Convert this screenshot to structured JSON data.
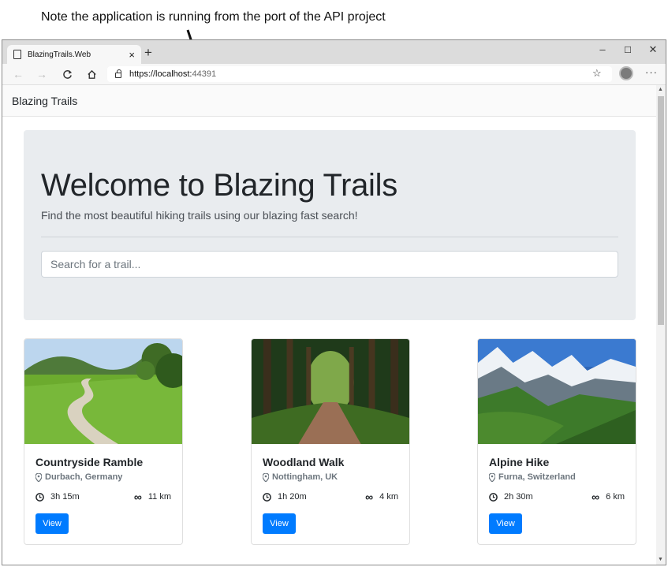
{
  "annotation": "Note the application is running from the port of the API project",
  "browser": {
    "tab_title": "BlazingTrails.Web",
    "tab_close": "×",
    "new_tab": "+",
    "window_controls": {
      "minimize": "–",
      "maximize": "☐",
      "close": "✕"
    },
    "url_host": "https://localhost:",
    "url_port": "44391",
    "more": "···"
  },
  "site": {
    "brand": "Blazing Trails",
    "hero": {
      "title": "Welcome to Blazing Trails",
      "lead": "Find the most beautiful hiking trails using our blazing fast search!",
      "search_placeholder": "Search for a trail..."
    },
    "trails": [
      {
        "name": "Countryside Ramble",
        "location": "Durbach, Germany",
        "time": "3h 15m",
        "distance": "11 km",
        "button": "View"
      },
      {
        "name": "Woodland Walk",
        "location": "Nottingham, UK",
        "time": "1h 20m",
        "distance": "4 km",
        "button": "View"
      },
      {
        "name": "Alpine Hike",
        "location": "Furna, Switzerland",
        "time": "2h 30m",
        "distance": "6 km",
        "button": "View"
      }
    ]
  },
  "icons": [
    "page-icon",
    "back-icon",
    "forward-icon",
    "refresh-icon",
    "home-icon",
    "lock-icon",
    "favorites-icon",
    "profile-avatar",
    "more-icon",
    "pin-icon",
    "clock-icon",
    "infinity-icon"
  ],
  "colors": {
    "primary": "#007bff",
    "jumbotron": "#e9ecef",
    "muted": "#6c757d"
  }
}
